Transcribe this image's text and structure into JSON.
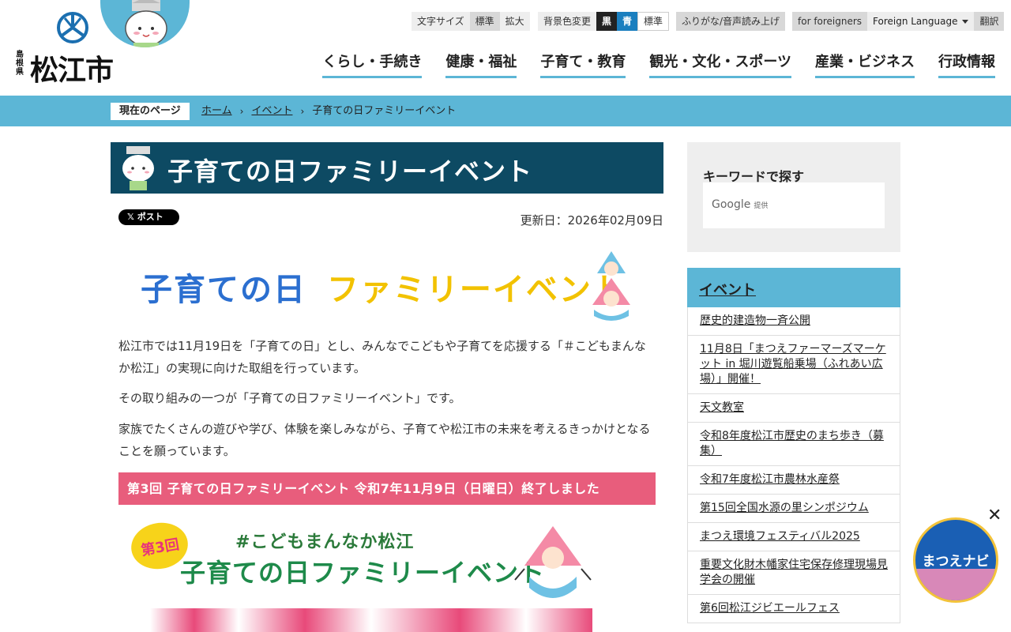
{
  "header": {
    "logo_pref": "島根県",
    "logo_city": "松江市",
    "utility": {
      "font_size_label": "文字サイズ",
      "font_standard": "標準",
      "font_large": "拡大",
      "bg_label": "背景色変更",
      "bg_black": "黒",
      "bg_blue": "青",
      "bg_standard": "標準",
      "furigana": "ふりがな/音声読み上げ",
      "foreigners": "for foreigners",
      "foreign_language": "Foreign Language",
      "translate": "翻訳"
    },
    "nav": [
      "くらし・手続き",
      "健康・福祉",
      "子育て・教育",
      "観光・文化・スポーツ",
      "産業・ビジネス",
      "行政情報"
    ]
  },
  "breadcrumb": {
    "label": "現在のページ",
    "items": [
      "ホーム",
      "イベント",
      "子育ての日ファミリーイベント"
    ]
  },
  "main": {
    "title": "子育ての日ファミリーイベント",
    "xpost": "𝕏 ポスト",
    "updated": "更新日：2026年02月09日",
    "banner_text_a": "子育ての日",
    "banner_text_b": "ファミリーイベント",
    "p1": "松江市では11月19日を「子育ての日」とし、みんなでこどもや子育てを応援する「＃こどもまんなか松江」の実現に向けた取組を行っています。",
    "p2": "その取り組みの一つが「子育ての日ファミリーイベント」です。",
    "p3": "家族でたくさんの遊びや学び、体験を楽しみながら、子育てや松江市の未来を考えるきっかけとなることを願っています。",
    "section_heading": "第3回 子育ての日ファミリーイベント 令和7年11月9日（日曜日）終了しました",
    "poster": {
      "badge": "第3回",
      "hashtag": "#こどもまんなか松江",
      "title": "子育ての日ファミリーイベント"
    }
  },
  "sidebar": {
    "search_title": "キーワードで探す",
    "google": "Google",
    "google_sub": "提供",
    "events_title": "イベント",
    "events": [
      "歴史的建造物一斉公開",
      "11月8日「まつえファーマーズマーケット in 堀川遊覧船乗場（ふれあい広場）」開催！",
      "天文教室",
      "令和8年度松江市歴史のまち歩き（募集）",
      "令和7年度松江市農林水産祭",
      "第15回全国水源の里シンポジウム",
      "まつえ環境フェスティバル2025",
      "重要文化財木幡家住宅保存修理現場見学会の開催",
      "第6回松江ジビエールフェス"
    ]
  },
  "navi": {
    "label": "まつえナビ",
    "close": "✕"
  }
}
